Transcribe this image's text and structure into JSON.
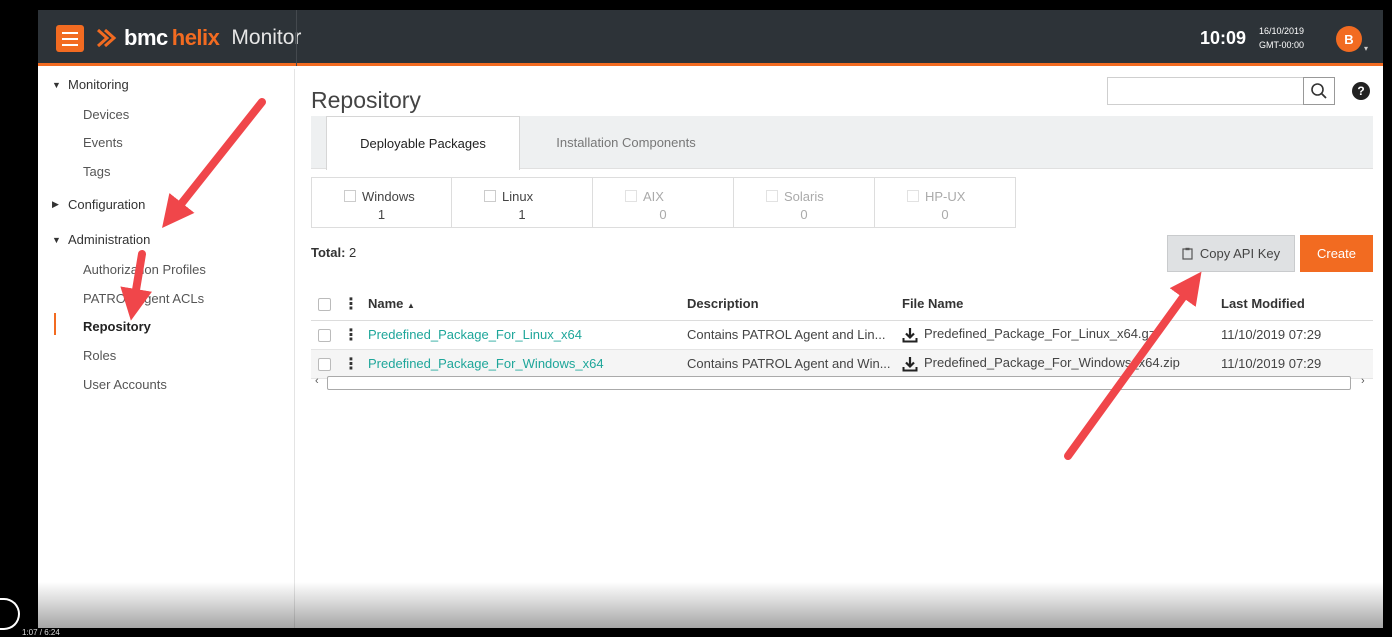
{
  "app": {
    "brand_bmc": "bmc",
    "brand_helix": "helix",
    "product": "Monitor",
    "time": "10:09",
    "date": "16/10/2019",
    "timezone": "GMT-00:00",
    "user_initial": "B"
  },
  "sidebar": {
    "groups": [
      {
        "label": "Monitoring",
        "expanded": true
      },
      {
        "label": "Configuration",
        "expanded": false
      },
      {
        "label": "Administration",
        "expanded": true
      }
    ],
    "monitoring_items": [
      "Devices",
      "Events",
      "Tags"
    ],
    "administration_items": [
      "Authorization Profiles",
      "PATROL Agent ACLs",
      "Repository",
      "Roles",
      "User Accounts"
    ],
    "active_item": "Repository"
  },
  "main": {
    "title": "Repository",
    "search": {
      "placeholder": "",
      "value": ""
    },
    "tabs": [
      {
        "label": "Deployable Packages",
        "active": true
      },
      {
        "label": "Installation Components",
        "active": false
      }
    ],
    "filters": [
      {
        "label": "Windows",
        "count": "1",
        "enabled": true
      },
      {
        "label": "Linux",
        "count": "1",
        "enabled": true
      },
      {
        "label": "AIX",
        "count": "0",
        "enabled": false
      },
      {
        "label": "Solaris",
        "count": "0",
        "enabled": false
      },
      {
        "label": "HP-UX",
        "count": "0",
        "enabled": false
      }
    ],
    "total_label": "Total:",
    "total_value": "2",
    "copy_api_key_label": "Copy API Key",
    "create_label": "Create",
    "table": {
      "columns": [
        "Name",
        "Description",
        "File Name",
        "Last Modified"
      ],
      "sort_indicator": "▲",
      "rows": [
        {
          "name": "Predefined_Package_For_Linux_x64",
          "description": "Contains PATROL Agent and Lin...",
          "file_name": "Predefined_Package_For_Linux_x64.gz",
          "last_modified": "11/10/2019 07:29"
        },
        {
          "name": "Predefined_Package_For_Windows_x64",
          "description": "Contains PATROL Agent and Win...",
          "file_name": "Predefined_Package_For_Windows_x64.zip",
          "last_modified": "11/10/2019 07:29"
        }
      ]
    }
  },
  "video": {
    "timecode": "1:07 / 6:24"
  },
  "colors": {
    "accent": "#f26b21",
    "topbar": "#2d3338",
    "link": "#1ea69a",
    "annotation_arrow": "#f0464a"
  }
}
